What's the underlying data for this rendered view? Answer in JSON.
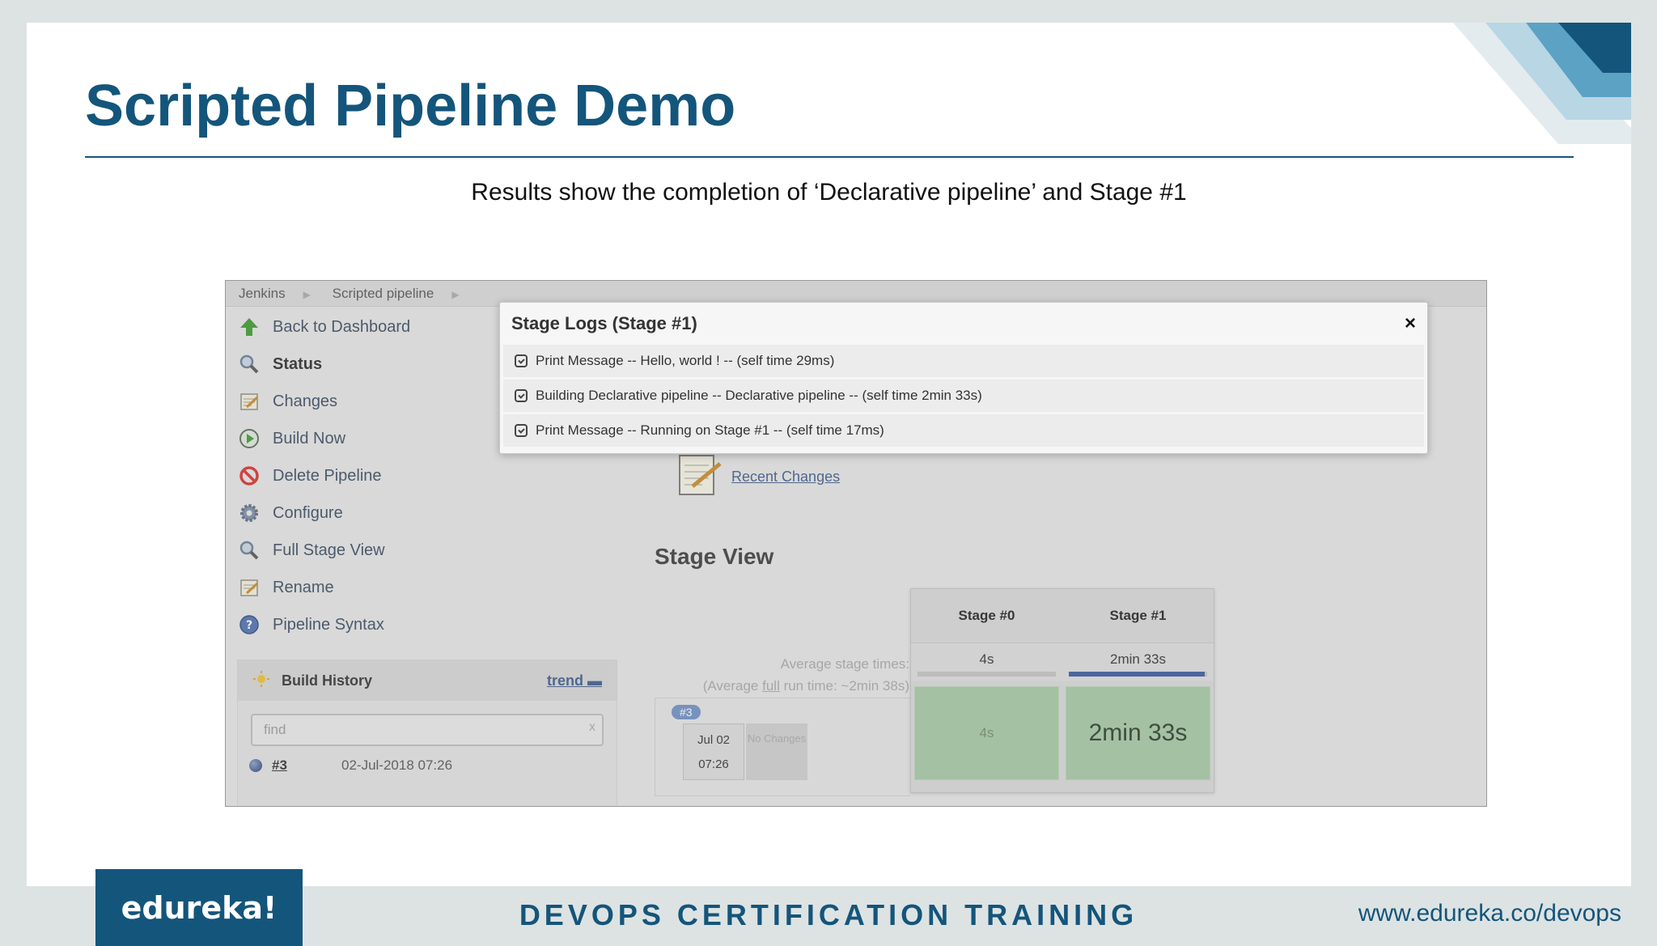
{
  "slide": {
    "title": "Scripted Pipeline Demo",
    "subtitle": "Results show the completion of ‘Declarative pipeline’ and Stage #1"
  },
  "jenkins": {
    "breadcrumbs": [
      "Jenkins",
      "Scripted pipeline"
    ],
    "sidebar": [
      {
        "label": "Back to Dashboard",
        "icon": "up-arrow-icon"
      },
      {
        "label": "Status",
        "icon": "magnifier-icon"
      },
      {
        "label": "Changes",
        "icon": "notepad-icon"
      },
      {
        "label": "Build Now",
        "icon": "clock-play-icon"
      },
      {
        "label": "Delete Pipeline",
        "icon": "no-entry-icon"
      },
      {
        "label": "Configure",
        "icon": "gear-icon"
      },
      {
        "label": "Full Stage View",
        "icon": "magnifier-icon"
      },
      {
        "label": "Rename",
        "icon": "notepad-icon"
      },
      {
        "label": "Pipeline Syntax",
        "icon": "help-icon"
      }
    ],
    "build_history": {
      "title": "Build History",
      "trend_label": "trend",
      "find_placeholder": "find",
      "find_clear": "x",
      "builds": [
        {
          "number": "#3",
          "date": "02-Jul-2018 07:26"
        }
      ]
    },
    "recent_changes": "Recent Changes",
    "stage_view": {
      "title": "Stage View",
      "avg_times_label": "Average stage times:",
      "avg_full_prefix": "(Average ",
      "avg_full_word": "full",
      "avg_full_suffix": " run time: ~2min 38s)",
      "stages": [
        "Stage #0",
        "Stage #1"
      ],
      "avg_times": [
        "4s",
        "2min 33s"
      ],
      "avg_progress": [
        0.0,
        0.98
      ],
      "run": {
        "badge": "#3",
        "date": "Jul 02",
        "time": "07:26",
        "changes": "No Changes",
        "stage_times": [
          "4s",
          "2min 33s"
        ]
      }
    },
    "modal": {
      "title": "Stage Logs (Stage #1)",
      "close": "×",
      "logs": [
        "Print Message -- Hello, world ! -- (self time 29ms)",
        "Building Declarative pipeline -- Declarative pipeline -- (self time 2min 33s)",
        "Print Message -- Running on Stage #1 -- (self time 17ms)"
      ]
    }
  },
  "footer": {
    "logo": "edureka!",
    "title": "DEVOPS CERTIFICATION TRAINING",
    "url": "www.edureka.co/devops"
  },
  "colors": {
    "brand": "#14557b",
    "stage_success": "#a7c9a5"
  }
}
